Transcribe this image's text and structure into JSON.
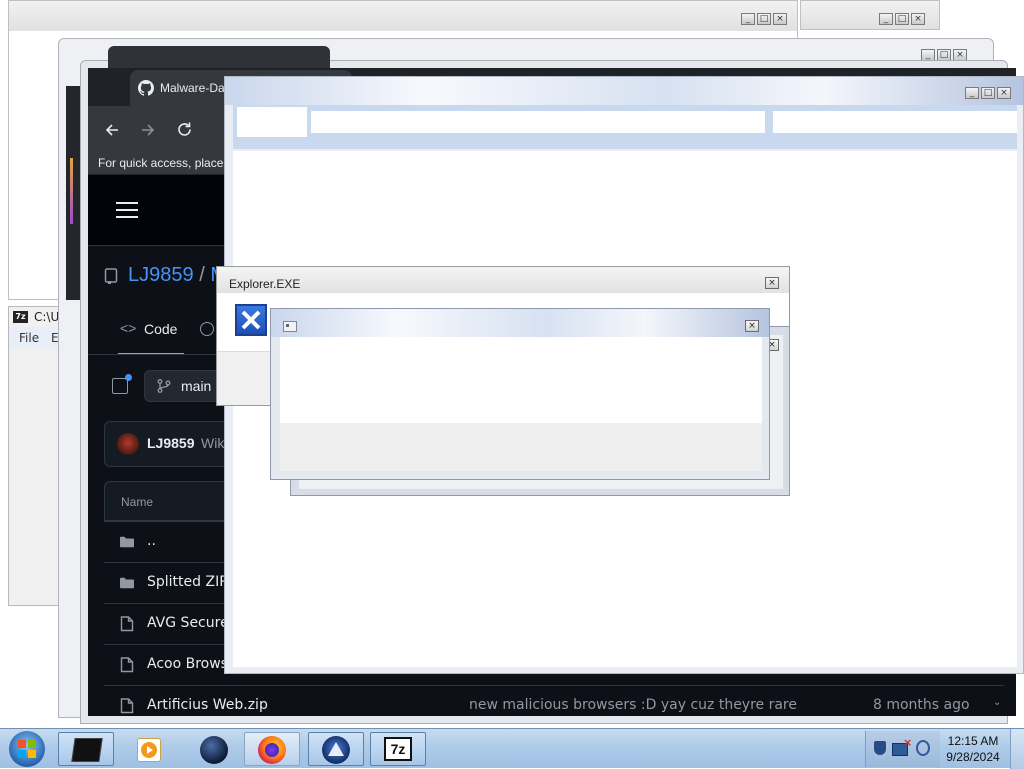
{
  "back_window": {
    "menu": [
      "File",
      "Edit"
    ],
    "title": "C:\\Users\\"
  },
  "browser": {
    "tab_title": "Malware-Da",
    "bookmarks_hint": "For quick access, place y",
    "repo_owner": "LJ9859",
    "repo_sep": "/",
    "repo_name_initial": "M",
    "nav_tab": "Code",
    "branch": "main",
    "commit_user": "LJ9859",
    "commit_msg": "Wik",
    "table_header": "Name",
    "rows": [
      {
        "name": "..",
        "type": "folder",
        "message": "",
        "age": ""
      },
      {
        "name": "Splitted ZIPs",
        "type": "folder",
        "message": "",
        "age": ""
      },
      {
        "name": "AVG Secure",
        "type": "file",
        "message": "",
        "age": ""
      },
      {
        "name": "Acoo Browse",
        "type": "file",
        "message": "",
        "age": ""
      },
      {
        "name": "Artificius Web.zip",
        "type": "file",
        "message": "new malicious browsers :D yay cuz theyre rare",
        "age": "8 months ago"
      }
    ]
  },
  "explorer_dialog": {
    "title": "Explorer.EXE"
  },
  "taskbar": {
    "time": "12:15 AM",
    "date": "9/28/2024"
  }
}
